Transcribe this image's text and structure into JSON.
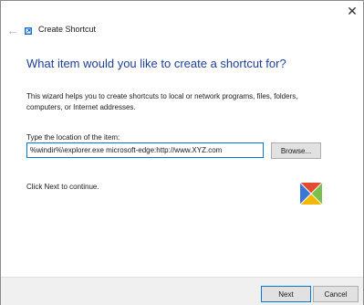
{
  "window": {
    "title": "Create Shortcut",
    "close_glyph": "✕",
    "back_glyph": "←"
  },
  "heading": "What item would you like to create a shortcut for?",
  "description": "This wizard helps you to create shortcuts to local or network programs, files, folders, computers, or Internet addresses.",
  "location": {
    "label": "Type the location of the item:",
    "value": "%windir%\\explorer.exe microsoft-edge:http://www.XYZ.com",
    "browse_label": "Browse..."
  },
  "hint": "Click Next to continue.",
  "footer": {
    "next_label": "Next",
    "cancel_label": "Cancel"
  },
  "colors": {
    "accent": "#0078d7",
    "heading": "#1e3f9b"
  },
  "icons": {
    "title": "shortcut-wizard-icon",
    "illustration": "colorful-x-tile-icon"
  }
}
